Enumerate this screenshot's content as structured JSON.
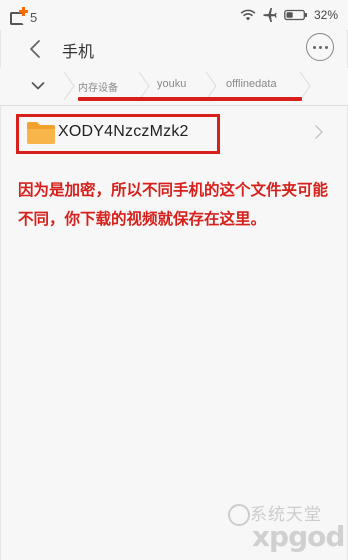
{
  "status_bar": {
    "notification_count": "5",
    "battery_percent": "32%",
    "icons": [
      "app-notification-icon",
      "wifi-icon",
      "airplane-mode-icon",
      "battery-icon"
    ]
  },
  "header": {
    "title": "手机",
    "back_icon": "back-arrow-icon",
    "more_icon": "more-options-icon"
  },
  "breadcrumb": {
    "toggle_icon": "chevron-down-icon",
    "items": [
      {
        "label": "内存设备"
      },
      {
        "label": "youku"
      },
      {
        "label": "offlinedata"
      }
    ]
  },
  "file_list": {
    "items": [
      {
        "name": "XODY4NzczMzk2",
        "icon": "folder-icon",
        "chevron": "chevron-right-icon"
      }
    ]
  },
  "annotation": {
    "text": "因为是加密，所以不同手机的这个文件夹可能不同，你下载的视频就保存在这里。"
  },
  "watermark": {
    "line1": "系统天堂",
    "line2": "xpgod"
  },
  "colors": {
    "annotation": "#d7201b",
    "folder": "#f6a623",
    "background": "#f7f7f7"
  }
}
